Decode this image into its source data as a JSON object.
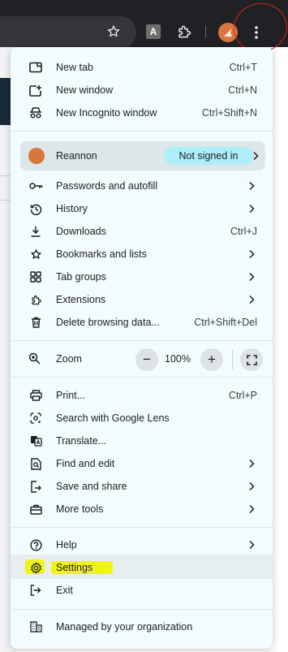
{
  "toolbar": {
    "extension_letter": "A"
  },
  "menu": {
    "group1": [
      {
        "label": "New tab",
        "shortcut": "Ctrl+T"
      },
      {
        "label": "New window",
        "shortcut": "Ctrl+N"
      },
      {
        "label": "New Incognito window",
        "shortcut": "Ctrl+Shift+N"
      }
    ],
    "profile": {
      "name": "Reannon",
      "status": "Not signed in"
    },
    "group2": [
      {
        "label": "Passwords and autofill"
      },
      {
        "label": "History"
      },
      {
        "label": "Downloads",
        "shortcut": "Ctrl+J"
      },
      {
        "label": "Bookmarks and lists"
      },
      {
        "label": "Tab groups"
      },
      {
        "label": "Extensions"
      },
      {
        "label": "Delete browsing data...",
        "shortcut": "Ctrl+Shift+Del"
      }
    ],
    "zoom": {
      "label": "Zoom",
      "value": "100%",
      "minus": "−",
      "plus": "+"
    },
    "group3": [
      {
        "label": "Print...",
        "shortcut": "Ctrl+P"
      },
      {
        "label": "Search with Google Lens"
      },
      {
        "label": "Translate..."
      },
      {
        "label": "Find and edit"
      },
      {
        "label": "Save and share"
      },
      {
        "label": "More tools"
      }
    ],
    "group4": [
      {
        "label": "Help"
      },
      {
        "label": "Settings"
      },
      {
        "label": "Exit"
      }
    ],
    "managed": "Managed by your organization"
  },
  "colors": {
    "menu_bg": "#f2fbfd",
    "badge_bg": "#aeeefa",
    "highlight": "#f0f20d",
    "annotation": "#e0201c"
  }
}
